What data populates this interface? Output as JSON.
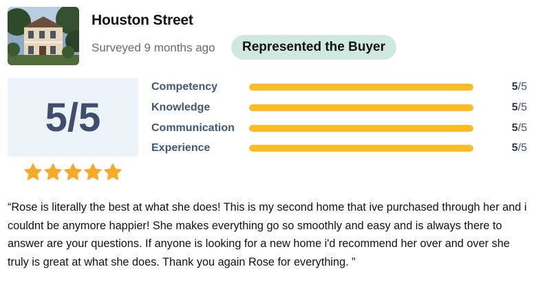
{
  "listing": {
    "title": "Houston Street",
    "surveyed": "Surveyed 9 months ago",
    "badge": "Represented the Buyer",
    "photo_icon": "house-photo"
  },
  "overall": {
    "score_text": "5/5",
    "stars": 5,
    "star_color": "#f7a928"
  },
  "ratings": [
    {
      "label": "Competency",
      "score": "5",
      "max": "/5",
      "fraction": 1.0
    },
    {
      "label": "Knowledge",
      "score": "5",
      "max": "/5",
      "fraction": 1.0
    },
    {
      "label": "Communication",
      "score": "5",
      "max": "/5",
      "fraction": 1.0
    },
    {
      "label": "Experience",
      "score": "5",
      "max": "/5",
      "fraction": 1.0
    }
  ],
  "review": {
    "text": "“Rose is literally the best at what she does! This is my second home that ive purchased through her and i couldnt be anymore happier! She makes everything go so smoothly and easy and is always there to answer are your questions. If anyone is looking for a new home i'd recommend her over and over she truly is great at what she does. Thank you again Rose for everything. ”"
  },
  "colors": {
    "bar_fill": "#fbbc24",
    "badge_bg": "#cfe9e1",
    "score_bg": "#edf1f8",
    "label_color": "#42557a"
  }
}
